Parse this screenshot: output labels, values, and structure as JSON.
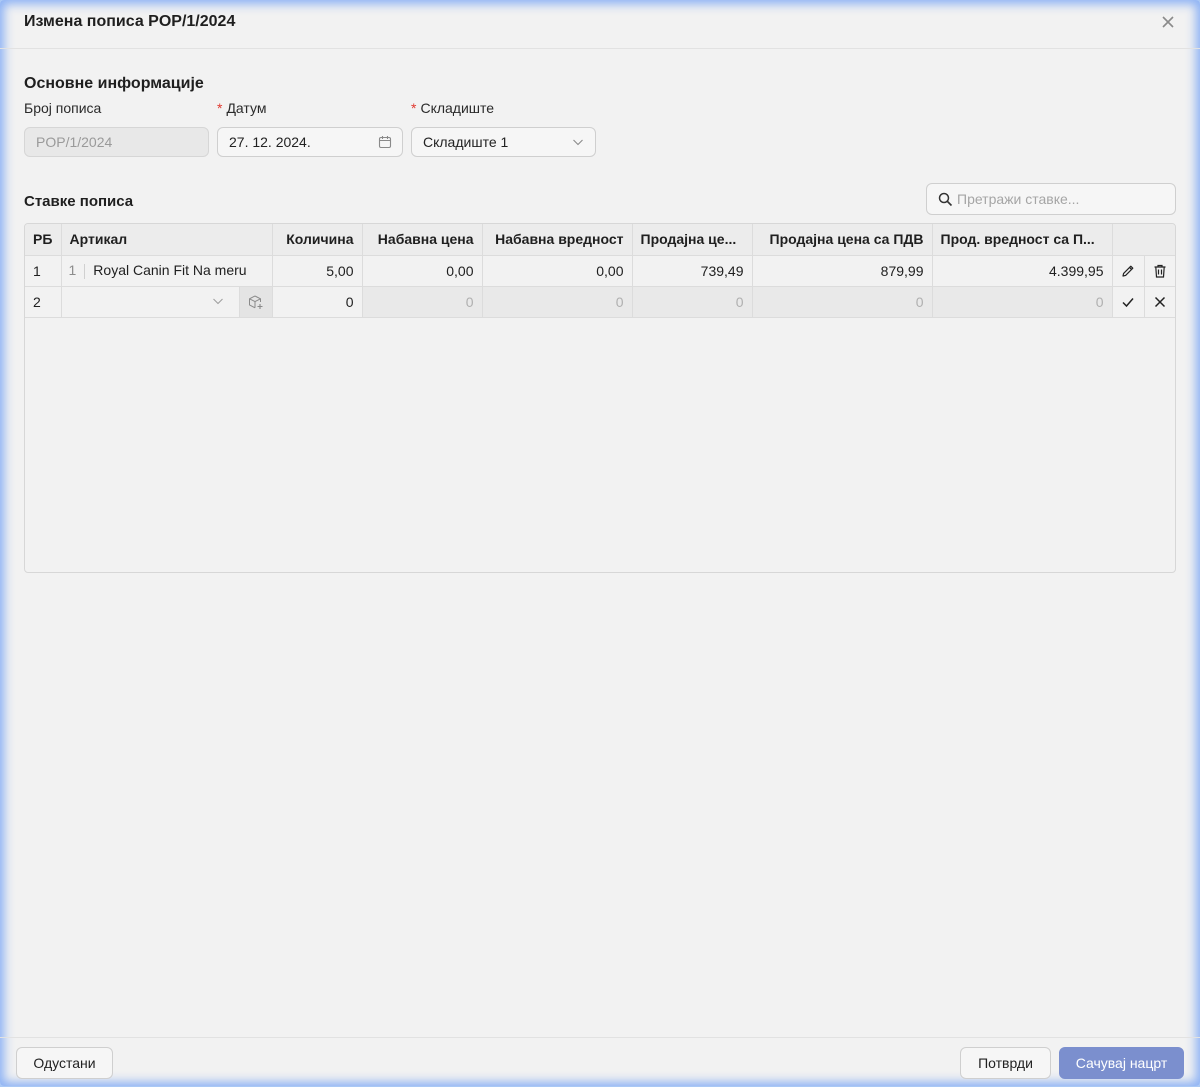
{
  "dialog": {
    "title": "Измена пописа POP/1/2024"
  },
  "basic_info": {
    "section_title": "Основне информације",
    "number_label": "Број пописа",
    "number_value": "POP/1/2024",
    "date_label": "Датум",
    "date_value": "27. 12. 2024.",
    "warehouse_label": "Складиште",
    "warehouse_value": "Складиште 1",
    "required_mark": "*"
  },
  "items": {
    "section_title": "Ставке пописа",
    "search_placeholder": "Претражи ставке...",
    "columns": [
      "РБ",
      "Артикал",
      "Количина",
      "Набавна цена",
      "Набавна вредност",
      "Продајна це...",
      "Продајна цена са ПДВ",
      "Прод. вредност са П..."
    ],
    "rows": [
      {
        "rb": "1",
        "article_code": "1",
        "article_name": "Royal Canin Fit Na meru",
        "quantity": "5,00",
        "purchase_price": "0,00",
        "purchase_value": "0,00",
        "sale_price": "739,49",
        "sale_price_vat": "879,99",
        "sale_value_vat": "4.399,95"
      }
    ],
    "new_row": {
      "rb": "2",
      "quantity": "0",
      "purchase_price": "0",
      "purchase_value": "0",
      "sale_price": "0",
      "sale_price_vat": "0",
      "sale_value_vat": "0"
    }
  },
  "footer": {
    "cancel_label": "Одустани",
    "confirm_label": "Потврди",
    "save_draft_label": "Сачувај нацрт"
  },
  "colors": {
    "accent": "#7b8fce",
    "required": "#e0382f",
    "background": "#f2f2f2"
  }
}
